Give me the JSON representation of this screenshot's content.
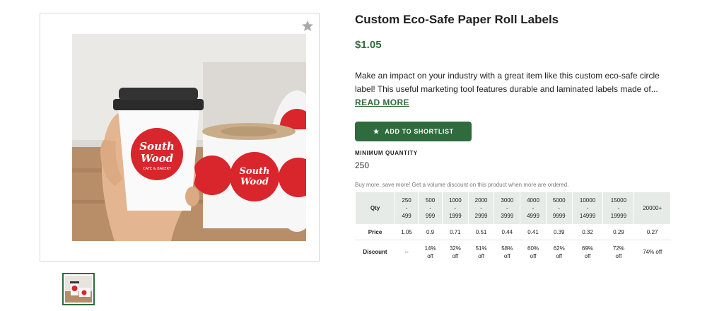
{
  "gallery": {
    "favorite_icon": "star-icon",
    "image_subject": "coffee cup and roll of circle labels",
    "label_text": {
      "line1": "South",
      "line2": "Wood",
      "line3": "CAFE & BAKERY"
    }
  },
  "product": {
    "title": "Custom Eco-Safe Paper Roll Labels",
    "price": "$1.05",
    "description": "Make an impact on your industry with a great item like this custom eco-safe circle label! This useful marketing tool features durable and laminated labels made of...",
    "read_more": "READ MORE",
    "shortlist_button": "ADD TO SHORTLIST",
    "min_qty_label": "MINIMUM QUANTITY",
    "min_qty_value": "250",
    "promo_text": "Buy more, save more! Get a volume discount on this product when more are ordered."
  },
  "pricing_table": {
    "row_labels": {
      "qty": "Qty",
      "price": "Price",
      "discount": "Discount"
    },
    "tiers": [
      {
        "qty_from": "250",
        "sep": "-",
        "qty_to": "499",
        "price": "1.05",
        "discount_pct": "--",
        "discount_word": ""
      },
      {
        "qty_from": "500",
        "sep": "-",
        "qty_to": "999",
        "price": "0.9",
        "discount_pct": "14%",
        "discount_word": "off"
      },
      {
        "qty_from": "1000",
        "sep": "-",
        "qty_to": "1999",
        "price": "0.71",
        "discount_pct": "32%",
        "discount_word": "off"
      },
      {
        "qty_from": "2000",
        "sep": "-",
        "qty_to": "2999",
        "price": "0.51",
        "discount_pct": "51%",
        "discount_word": "off"
      },
      {
        "qty_from": "3000",
        "sep": "-",
        "qty_to": "3999",
        "price": "0.44",
        "discount_pct": "58%",
        "discount_word": "off"
      },
      {
        "qty_from": "4000",
        "sep": "-",
        "qty_to": "4999",
        "price": "0.41",
        "discount_pct": "60%",
        "discount_word": "off"
      },
      {
        "qty_from": "5000",
        "sep": "-",
        "qty_to": "9999",
        "price": "0.39",
        "discount_pct": "62%",
        "discount_word": "off"
      },
      {
        "qty_from": "10000",
        "sep": "-",
        "qty_to": "14999",
        "price": "0.32",
        "discount_pct": "69%",
        "discount_word": "off"
      },
      {
        "qty_from": "15000",
        "sep": "-",
        "qty_to": "19999",
        "price": "0.29",
        "discount_pct": "72%",
        "discount_word": "off"
      },
      {
        "qty_from": "20000+",
        "sep": "",
        "qty_to": "",
        "price": "0.27",
        "discount_pct": "74% off",
        "discount_word": ""
      }
    ]
  },
  "colors": {
    "brand_green": "#2f6b3c",
    "table_header_bg": "#e6ebe7",
    "label_red": "#d8262c"
  }
}
